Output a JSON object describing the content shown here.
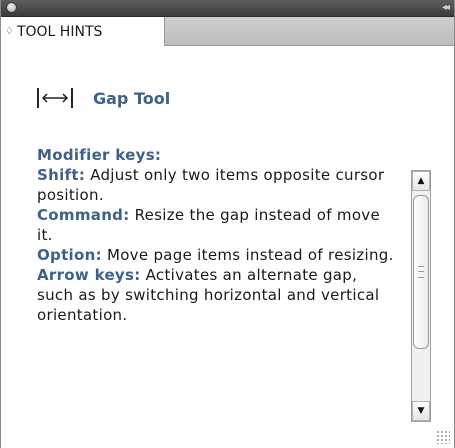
{
  "panel": {
    "tab_label": "TOOL HINTS",
    "tab_arrows": "♢",
    "collapse_glyph": "◂◂"
  },
  "tool": {
    "name": "Gap Tool",
    "icon": "gap-tool-icon"
  },
  "hints": {
    "heading": "Modifier keys:",
    "items": [
      {
        "key": "Shift:",
        "text": " Adjust only two items opposite cursor position."
      },
      {
        "key": "Command:",
        "text": " Resize the gap instead of move it."
      },
      {
        "key": "Option:",
        "text": " Move page items instead of resizing."
      },
      {
        "key": "Arrow keys:",
        "text": " Activates an alternate gap, such as by switching horizontal and vertical orientation."
      }
    ]
  },
  "scrollbar": {
    "up_glyph": "▲",
    "down_glyph": "▼"
  },
  "colors": {
    "accent": "#3d6187",
    "titlebar": "#4a4a4a"
  }
}
